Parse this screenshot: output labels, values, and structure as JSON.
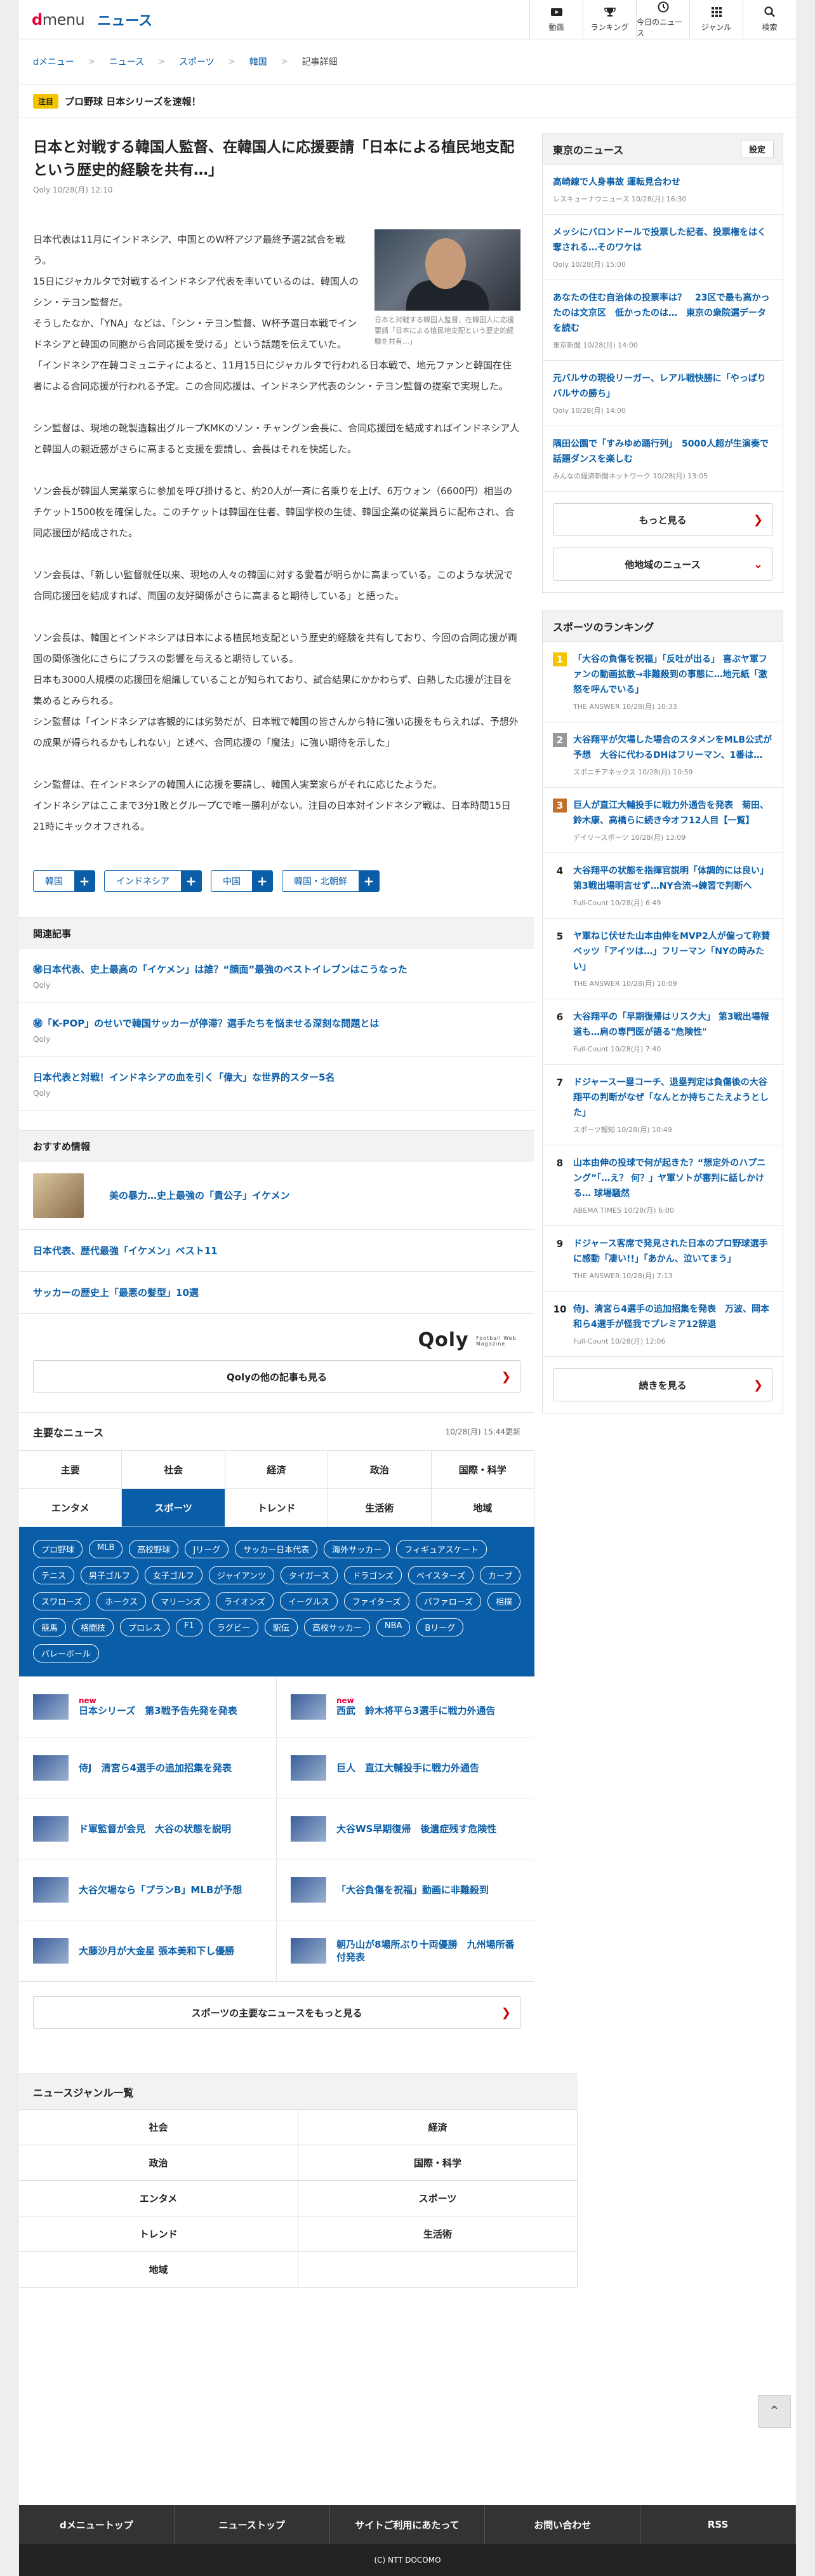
{
  "header": {
    "logo_d": "d",
    "logo_menu": "menu",
    "section": "ニュース",
    "nav": [
      {
        "icon": "video-icon",
        "label": "動画"
      },
      {
        "icon": "trophy-icon",
        "label": "ランキング"
      },
      {
        "icon": "clock-icon",
        "label": "今日のニュース"
      },
      {
        "icon": "grid-icon",
        "label": "ジャンル"
      },
      {
        "icon": "search-icon",
        "label": "検索"
      }
    ]
  },
  "breadcrumb": [
    "dメニュー",
    "ニュース",
    "スポーツ",
    "韓国",
    "記事詳細"
  ],
  "notice": {
    "tag": "注目",
    "text": "プロ野球 日本シリーズを速報！"
  },
  "article": {
    "title": "日本と対戦する韓国人監督、在韓国人に応援要請「日本による植民地支配という歴史的経験を共有…」",
    "meta": "Qoly 10/28(月) 12:10",
    "caption": "日本と対戦する韓国人監督、在韓国人に応援要請「日本による植民地支配という歴史的経験を共有…」",
    "paragraphs": [
      [
        "日本代表は11月にインドネシア、中国とのW杯アジア最終予選2試合を戦う。",
        "15日にジャカルタで対戦するインドネシア代表を率いているのは、韓国人のシン・テヨン監督だ。",
        "そうしたなか、「YNA」などは、「シン・テヨン監督、W杯予選日本戦でインドネシアと韓国の同胞から合同応援を受ける」という話題を伝えていた。",
        "「インドネシア在韓コミュニティによると、11月15日にジャカルタで行われる日本戦で、地元ファンと韓国在住者による合同応援が行われる予定。この合同応援は、インドネシア代表のシン・テヨン監督の提案で実現した。"
      ],
      [
        "シン監督は、現地の靴製造輸出グループKMKのソン・チャングン会長に、合同応援団を結成すればインドネシア人と韓国人の親近感がさらに高まると支援を要請し、会長はそれを快諾した。"
      ],
      [
        "ソン会長が韓国人実業家らに参加を呼び掛けると、約20人が一斉に名乗りを上げ、6万ウォン（6600円）相当のチケット1500枚を確保した。このチケットは韓国在住者、韓国学校の生徒、韓国企業の従業員らに配布され、合同応援団が結成された。"
      ],
      [
        "ソン会長は、「新しい監督就任以来、現地の人々の韓国に対する愛着が明らかに高まっている。このような状況で合同応援団を結成すれば、両国の友好関係がさらに高まると期待している」と語った。"
      ],
      [
        "ソン会長は、韓国とインドネシアは日本による植民地支配という歴史的経験を共有しており、今回の合同応援が両国の関係強化にさらにプラスの影響を与えると期待している。",
        "日本も3000人規模の応援団を組織していることが知られており、試合結果にかかわらず、白熱した応援が注目を集めるとみられる。",
        "シン監督は「インドネシアは客観的には劣勢だが、日本戦で韓国の皆さんから特に強い応援をもらえれば、予想外の成果が得られるかもしれない」と述べ、合同応援の「魔法」に強い期待を示した」"
      ],
      [
        "シン監督は、在インドネシアの韓国人に応援を要請し、韓国人実業家らがそれに応じたようだ。",
        "インドネシアはここまで3分1敗とグループCで唯一勝利がない。注目の日本対インドネシア戦は、日本時間15日21時にキックオフされる。"
      ]
    ],
    "tags": [
      "韓国",
      "インドネシア",
      "中国",
      "韓国・北朝鮮"
    ]
  },
  "related": {
    "heading": "関連記事",
    "items": [
      {
        "title": "㊙日本代表、史上最高の「イケメン」は誰？“顔面”最強のベストイレブンはこうなった",
        "source": "Qoly"
      },
      {
        "title": "㊙「K-POP」のせいで韓国サッカーが停滞？選手たちを悩ませる深刻な問題とは",
        "source": "Qoly"
      },
      {
        "title": "日本代表と対戦！インドネシアの血を引く「偉大」な世界的スター5名",
        "source": "Qoly"
      }
    ]
  },
  "recommend": {
    "heading": "おすすめ情報",
    "top": "美の暴力…史上最強の「貴公子」イケメン",
    "items": [
      "日本代表、歴代最強「イケメン」ベスト11",
      "サッカーの歴史上「最悪の髪型」10選"
    ],
    "logo": "Qoly",
    "logo_sub": "Football Web Magazine",
    "more": "Qolyの他の記事も見る"
  },
  "major": {
    "heading": "主要なニュース",
    "updated": "10/28(月) 15:44更新",
    "categories": [
      "主要",
      "社会",
      "経済",
      "政治",
      "国際・科学",
      "エンタメ",
      "スポーツ",
      "トレンド",
      "生活術",
      "地域"
    ],
    "subcats": [
      "プロ野球",
      "MLB",
      "高校野球",
      "Jリーグ",
      "サッカー日本代表",
      "海外サッカー",
      "フィギュアスケート",
      "テニス",
      "男子ゴルフ",
      "女子ゴルフ",
      "ジャイアンツ",
      "タイガース",
      "ドラゴンズ",
      "ベイスターズ",
      "カープ",
      "スワローズ",
      "ホークス",
      "マリーンズ",
      "ライオンズ",
      "イーグルス",
      "ファイターズ",
      "バファローズ",
      "相撲",
      "競馬",
      "格闘技",
      "プロレス",
      "F1",
      "ラグビー",
      "駅伝",
      "高校サッカー",
      "NBA",
      "Bリーグ",
      "バレーボール"
    ],
    "news": [
      {
        "title": "日本シリーズ　第3戦予告先発を発表",
        "new": "new"
      },
      {
        "title": "西武　鈴木将平ら3選手に戦力外通告",
        "new": "new"
      },
      {
        "title": "侍J　清宮ら4選手の追加招集を発表",
        "new": ""
      },
      {
        "title": "巨人　直江大輔投手に戦力外通告",
        "new": ""
      },
      {
        "title": "ド軍監督が会見　大谷の状態を説明",
        "new": ""
      },
      {
        "title": "大谷WS早期復帰　後遺症残す危険性",
        "new": ""
      },
      {
        "title": "大谷欠場なら「プランB」MLBが予想",
        "new": ""
      },
      {
        "title": "「大谷負傷を祝福」動画に非難殺到",
        "new": ""
      },
      {
        "title": "大藤沙月が大金星 張本美和下し優勝",
        "new": ""
      },
      {
        "title": "朝乃山が8場所ぶり十両優勝　九州場所番付発表",
        "new": ""
      }
    ],
    "more": "スポーツの主要なニュースをもっと見る"
  },
  "tokyo": {
    "heading": "東京のニュース",
    "setting": "設定",
    "items": [
      {
        "title": "高崎線で人身事故 運転見合わせ",
        "source": "レスキューナウニュース 10/28(月) 16:30"
      },
      {
        "title": "メッシにバロンドールで投票した記者、投票権をはく奪される…そのワケは",
        "source": "Qoly 10/28(月) 15:00"
      },
      {
        "title": "あなたの住む自治体の投票率は？　23区で最も高かったのは文京区　低かったのは…　東京の衆院選データを読む",
        "source": "東京新聞 10/28(月) 14:00"
      },
      {
        "title": "元バルサの現役リーガー、レアル戦快勝に「やっぱりバルサの勝ち」",
        "source": "Qoly 10/28(月) 14:00"
      },
      {
        "title": "隅田公園で「すみゆめ踊行列」　5000人超が生演奏で話題ダンスを楽しむ",
        "source": "みんなの経済新聞ネットワーク 10/28(月) 13:05"
      }
    ],
    "more": "もっと見る",
    "other": "他地域のニュース"
  },
  "ranking": {
    "heading": "スポーツのランキング",
    "items": [
      {
        "no": "1",
        "title": "「大谷の負傷を祝福」「反吐が出る」 喜ぶヤ軍ファンの動画拡散→非難殺到の事態に…地元紙「激怒を呼んでいる」",
        "source": "THE ANSWER 10/28(月) 10:33"
      },
      {
        "no": "2",
        "title": "大谷翔平が欠場した場合のスタメンをMLB公式が予想　大谷に代わるDHはフリーマン、1番は…",
        "source": "スポニチアネックス 10/28(月) 10:59"
      },
      {
        "no": "3",
        "title": "巨人が直江大輔投手に戦力外通告を発表　菊田、鈴木康、高橋らに続き今オフ12人目【一覧】",
        "source": "デイリースポーツ 10/28(月) 13:09"
      },
      {
        "no": "4",
        "title": "大谷翔平の状態を指揮官説明「体調的には良い」第3戦出場明言せず…NY合流→練習で判断へ",
        "source": "Full-Count 10/28(月) 6:49"
      },
      {
        "no": "5",
        "title": "ヤ軍ねじ伏せた山本由伸をMVP2人が偏って称賛　ベッツ「アイツは…」フリーマン「NYの時みたい」",
        "source": "THE ANSWER 10/28(月) 10:09"
      },
      {
        "no": "6",
        "title": "大谷翔平の「早期復帰はリスク大」 第3戦出場報道も…肩の専門医が語る\"危険性\"",
        "source": "Full-Count 10/28(月) 7:40"
      },
      {
        "no": "7",
        "title": "ドジャース一塁コーチ、退塁判定は負傷後の大谷翔平の判断がなぜ「なんとか持ちこたえようとした」",
        "source": "スポーツ報知 10/28(月) 10:49"
      },
      {
        "no": "8",
        "title": "山本由伸の投球で何が起きた？“想定外のハプニング”「…え？ 何？」ヤ軍ソトが審判に話しかける… 球場騒然",
        "source": "ABEMA TIMES 10/28(月) 6:00"
      },
      {
        "no": "9",
        "title": "ドジャース客席で発見された日本のプロ野球選手に感動「凄い!!」「あかん、泣いてまう」",
        "source": "THE ANSWER 10/28(月) 7:13"
      },
      {
        "no": "10",
        "title": "侍J、清宮ら4選手の追加招集を発表　万波、岡本和ら4選手が怪我でプレミア12辞退",
        "source": "Full-Count 10/28(月) 12:06"
      }
    ],
    "more": "続きを見る"
  },
  "genre": {
    "heading": "ニュースジャンル一覧",
    "items": [
      "社会",
      "経済",
      "政治",
      "国際・科学",
      "エンタメ",
      "スポーツ",
      "トレンド",
      "生活術",
      "地域",
      ""
    ]
  },
  "footer": {
    "nav": [
      "dメニュートップ",
      "ニューストップ",
      "サイトご利用にあたって",
      "お問い合わせ",
      "RSS"
    ],
    "copyright": "(C) NTT DOCOMO"
  },
  "colors": {
    "brand": "#e60039",
    "link": "#0a5ea8",
    "rank1": "#f5c400",
    "rank2": "#999999",
    "rank3": "#c2702a"
  }
}
